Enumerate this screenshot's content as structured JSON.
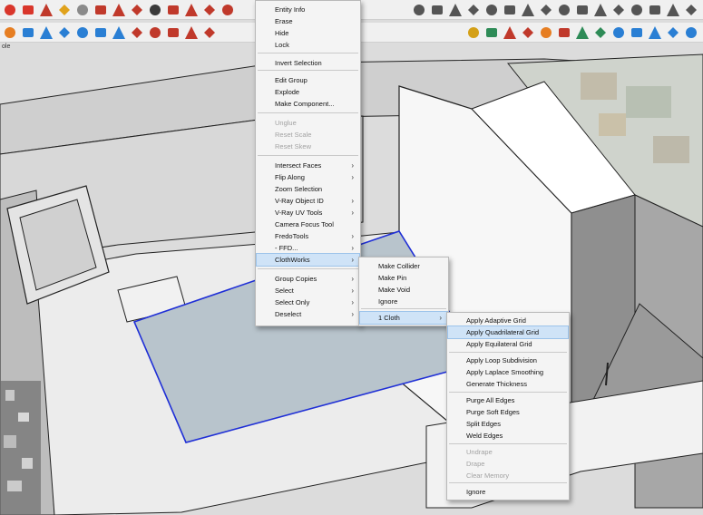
{
  "toolbar": {
    "top_icons": [
      {
        "icon": "move-icon",
        "color": "#d9362b"
      },
      {
        "icon": "rotate-icon",
        "color": "#d9362b"
      },
      {
        "icon": "scale-icon",
        "color": "#c0392b"
      },
      {
        "icon": "tape-measure-icon",
        "color": "#e0a21b"
      },
      {
        "icon": "text-icon",
        "color": "#8a8a8a"
      },
      {
        "icon": "paint-bucket-icon",
        "color": "#c0392b"
      },
      {
        "icon": "push-pull-icon",
        "color": "#c0392b"
      },
      {
        "icon": "follow-me-icon",
        "color": "#c0392b"
      },
      {
        "icon": "zoom-icon",
        "color": "#3a3a3a"
      },
      {
        "icon": "zoom-extents-icon",
        "color": "#c0392b"
      },
      {
        "icon": "component-icon",
        "color": "#c0392b"
      },
      {
        "icon": "material-icon",
        "color": "#c0392b"
      },
      {
        "icon": "extension-icon",
        "color": "#c0392b"
      }
    ],
    "top_right_icons": [
      {
        "icon": "orbit-icon",
        "color": "#555555"
      },
      {
        "icon": "cloud-icon",
        "color": "#555555"
      },
      {
        "icon": "section-plane-icon",
        "color": "#555555"
      },
      {
        "icon": "section-fill-icon",
        "color": "#555555"
      },
      {
        "icon": "view-iso-icon",
        "color": "#555555"
      },
      {
        "icon": "view-top-icon",
        "color": "#555555"
      },
      {
        "icon": "view-front-icon",
        "color": "#555555"
      },
      {
        "icon": "view-right-icon",
        "color": "#555555"
      },
      {
        "icon": "group-icon",
        "color": "#555555"
      },
      {
        "icon": "component-edit-icon",
        "color": "#555555"
      },
      {
        "icon": "xray-icon",
        "color": "#555555"
      },
      {
        "icon": "wireframe-icon",
        "color": "#555555"
      },
      {
        "icon": "hidden-line-icon",
        "color": "#555555"
      },
      {
        "icon": "shaded-icon",
        "color": "#555555"
      },
      {
        "icon": "textured-icon",
        "color": "#555555"
      },
      {
        "icon": "monochrome-icon",
        "color": "#555555"
      }
    ],
    "bottom_icons": [
      {
        "icon": "vray-settings-icon",
        "color": "#e67e22"
      },
      {
        "icon": "sphere-blue-icon",
        "color": "#2a7fd4"
      },
      {
        "icon": "sphere-gray-icon",
        "color": "#2a7fd4"
      },
      {
        "icon": "sphere-dark-icon",
        "color": "#2a7fd4"
      },
      {
        "icon": "light-icon",
        "color": "#2a7fd4"
      },
      {
        "icon": "camera-icon",
        "color": "#2a7fd4"
      },
      {
        "icon": "proxy-icon",
        "color": "#2a7fd4"
      },
      {
        "icon": "clipper-icon",
        "color": "#c0392b"
      },
      {
        "icon": "infinite-plane-icon",
        "color": "#c0392b"
      },
      {
        "icon": "mesh-light-icon",
        "color": "#c0392b"
      },
      {
        "icon": "fur-icon",
        "color": "#c0392b"
      },
      {
        "icon": "scatter-icon",
        "color": "#c0392b"
      }
    ],
    "bottom_right_icons": [
      {
        "icon": "extension-a-icon",
        "color": "#d4a017"
      },
      {
        "icon": "extension-b-icon",
        "color": "#2e8b57"
      },
      {
        "icon": "extension-c-icon",
        "color": "#c0392b"
      },
      {
        "icon": "extension-d-icon",
        "color": "#c0392b"
      },
      {
        "icon": "extension-e-icon",
        "color": "#e67e22"
      },
      {
        "icon": "extension-f-icon",
        "color": "#c0392b"
      },
      {
        "icon": "extension-g-icon",
        "color": "#2e8b57"
      },
      {
        "icon": "extension-h-icon",
        "color": "#2e8b57"
      },
      {
        "icon": "extension-i-icon",
        "color": "#2a7fd4"
      },
      {
        "icon": "extension-j-icon",
        "color": "#2a7fd4"
      },
      {
        "icon": "extension-k-icon",
        "color": "#2a7fd4"
      },
      {
        "icon": "extension-l-icon",
        "color": "#2a7fd4"
      },
      {
        "icon": "extension-m-icon",
        "color": "#2a7fd4"
      }
    ],
    "tray_label": "ole"
  },
  "context_menu": {
    "items": [
      {
        "label": "Entity Info"
      },
      {
        "label": "Erase"
      },
      {
        "label": "Hide"
      },
      {
        "label": "Lock"
      },
      {
        "label": "Invert Selection"
      },
      {
        "label": "Edit Group"
      },
      {
        "label": "Explode"
      },
      {
        "label": "Make Component..."
      },
      {
        "label": "Unglue",
        "disabled": true
      },
      {
        "label": "Reset Scale",
        "disabled": true
      },
      {
        "label": "Reset Skew",
        "disabled": true
      },
      {
        "label": "Intersect Faces",
        "submenu": true
      },
      {
        "label": "Flip Along",
        "submenu": true
      },
      {
        "label": "Zoom Selection"
      },
      {
        "label": "V-Ray Object ID",
        "submenu": true
      },
      {
        "label": "V-Ray UV Tools",
        "submenu": true
      },
      {
        "label": "Camera Focus Tool"
      },
      {
        "label": "FredoTools",
        "submenu": true
      },
      {
        "label": "- FFD...",
        "submenu": true
      },
      {
        "label": "ClothWorks",
        "submenu": true,
        "highlighted": true
      },
      {
        "label": "Group Copies",
        "submenu": true
      },
      {
        "label": "Select",
        "submenu": true
      },
      {
        "label": "Select Only",
        "submenu": true
      },
      {
        "label": "Deselect",
        "submenu": true
      }
    ]
  },
  "clothworks_menu": {
    "items": [
      {
        "label": "Make Collider"
      },
      {
        "label": "Make Pin"
      },
      {
        "label": "Make Void"
      },
      {
        "label": "Ignore"
      },
      {
        "label": "1 Cloth",
        "submenu": true,
        "highlighted": true
      }
    ]
  },
  "cloth_menu": {
    "items": [
      {
        "label": "Apply Adaptive Grid"
      },
      {
        "label": "Apply Quadrilateral Grid",
        "highlighted": true
      },
      {
        "label": "Apply Equilateral Grid"
      },
      {
        "label": "Apply Loop Subdivision"
      },
      {
        "label": "Apply Laplace Smoothing"
      },
      {
        "label": "Generate Thickness"
      },
      {
        "label": "Purge All Edges"
      },
      {
        "label": "Purge Soft Edges"
      },
      {
        "label": "Split Edges"
      },
      {
        "label": "Weld Edges"
      },
      {
        "label": "Undrape",
        "disabled": true
      },
      {
        "label": "Drape",
        "disabled": true
      },
      {
        "label": "Clear Memory",
        "disabled": true
      },
      {
        "label": "Ignore"
      }
    ]
  },
  "colors": {
    "selection_edge": "#1f2fd6",
    "selected_face": "#b7c3cc",
    "menu_highlight": "#cfe3f7"
  }
}
